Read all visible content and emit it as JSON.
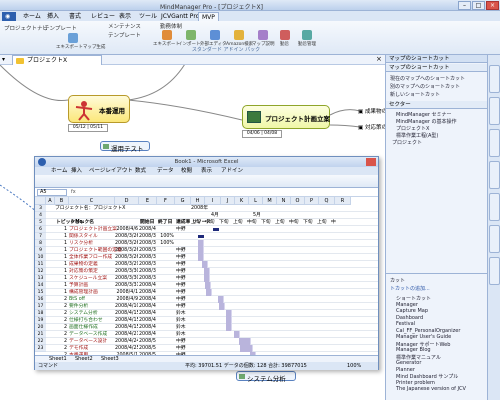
{
  "app": {
    "title": "MindManager Pro - [プロジェクトX]"
  },
  "window_buttons": [
    "–",
    "□",
    "×"
  ],
  "ribbon": {
    "tabs": [
      "ホーム",
      "挿入",
      "書式",
      "レビュー",
      "表示",
      "ツール",
      "JCVGantt Pro",
      "MVP"
    ],
    "left_labels": [
      "プロジェクトナビ",
      "テンプレート"
    ],
    "group2_items": [
      "メンテナンス",
      "テンプレート",
      "勤務体制"
    ],
    "group3_items": [
      "エキスポート",
      "インポート",
      "外部エディタ",
      "Amazon検索",
      "マップ説明",
      "勤怠",
      "勤怠管理"
    ],
    "group3_title": "スタンダード アドイン パック"
  },
  "doc": {
    "tab": "プロジェクトX"
  },
  "map": {
    "node1": "本番運用",
    "node1_dates": "05/12 | 05/11",
    "node2": "運用テスト",
    "node3": "プロジェクト計画立案",
    "node3_dates": "04/06 | 04/08",
    "subtopics": [
      "▣ 成果物の定義",
      "▣ 対応策の策定"
    ],
    "bottom_node": "システム分析"
  },
  "side_panel": {
    "title": "マップのショートカット",
    "sections": [
      "マップのショートカット",
      "セクター"
    ],
    "items": [
      "現在のマップへのショートカット",
      "別のマップへのショートカット",
      "新しいショートカット",
      "MindManager セミナー",
      "MindManager の基本操作",
      "プロジェクトX",
      "標準作業工程(A型)",
      "プロジェクト"
    ],
    "list_items": [
      "ショートカット",
      "Manager",
      "Capture Map",
      "Dashboard",
      "Festival",
      "Cal_FF_PersonalOrganizer",
      "Manager User's Guide",
      "Manager サポートWeb",
      "Manager Blog",
      "標準作業マニュアル",
      "Generator",
      "Planner",
      "Mind Dashboard サンプル",
      "Printer problem",
      "The Japanese version of JCV"
    ],
    "bottom_title": "カット",
    "bottom_link": "トカットの追加..."
  },
  "excel": {
    "title": "Book1 - Microsoft Excel",
    "tabs": [
      "ホーム",
      "挿入",
      "ページレイアウト",
      "数式",
      "データ",
      "校閲",
      "表示",
      "アドイン"
    ],
    "name_box": "A5",
    "columns": [
      "A",
      "B",
      "C",
      "D",
      "E",
      "F",
      "G",
      "H",
      "I",
      "J",
      "K",
      "L",
      "M",
      "N",
      "O",
      "P",
      "Q",
      "R"
    ],
    "sheet_title": "プロジェクト名：プロジェクトX",
    "year_label": "2008年",
    "month_labels": [
      "4月",
      "5月"
    ],
    "half_labels": [
      "上旬",
      "中旬",
      "下旬",
      "上旬",
      "中旬",
      "下旬",
      "上旬",
      "中旬",
      "下旬",
      "上旬",
      "中"
    ],
    "headers": [
      "トピックNo.",
      "トピック名",
      "開始日",
      "終了日",
      "達成率",
      "リソース"
    ],
    "rows": [
      {
        "no": "1",
        "name": "プロジェクト計画立案",
        "start": "2008/4/6",
        "end": "2008/4/8",
        "pct": "",
        "res": "中野"
      },
      {
        "no": "1",
        "name": "関係スタイル",
        "start": "2008/3/26",
        "end": "2008/3/28",
        "pct": "100%",
        "res": ""
      },
      {
        "no": "1",
        "name": "リスク分析",
        "start": "2008/3/26",
        "end": "2008/3/28",
        "pct": "100%",
        "res": ""
      },
      {
        "no": "1",
        "name": "プロジェクト範囲の定義",
        "start": "2008/3/26",
        "end": "2008/3/28",
        "pct": "",
        "res": "中野"
      },
      {
        "no": "1",
        "name": "全体作業フロー作成",
        "start": "2008/3/26",
        "end": "2008/3/28",
        "pct": "",
        "res": "中野"
      },
      {
        "no": "1",
        "name": "成果物の定義",
        "start": "2008/3/29",
        "end": "2008/3/30",
        "pct": "",
        "res": "中野"
      },
      {
        "no": "1",
        "name": "対応策の策定",
        "start": "2008/3/30",
        "end": "2008/3/31",
        "pct": "",
        "res": "中野"
      },
      {
        "no": "1",
        "name": "スケジュール立案",
        "start": "2008/3/30",
        "end": "2008/3/31",
        "pct": "",
        "res": "中野"
      },
      {
        "no": "1",
        "name": "予算計画",
        "start": "2008/3/31",
        "end": "2008/4/1",
        "pct": "",
        "res": "中野"
      },
      {
        "no": "1",
        "name": "構成管理計画",
        "start": "2008/4/1",
        "end": "2008/4/2",
        "pct": "",
        "res": "中野"
      },
      {
        "no": "2",
        "name": "BtS off",
        "start": "2008/4/9",
        "end": "2008/4/9",
        "pct": "",
        "res": "中野"
      },
      {
        "no": "2",
        "name": "要件分析",
        "start": "2008/4/10",
        "end": "2008/4/11",
        "pct": "",
        "res": "中野"
      },
      {
        "no": "2",
        "name": "システム分析",
        "start": "2008/4/15",
        "end": "2008/4/16",
        "pct": "",
        "res": "鈴木"
      },
      {
        "no": "2",
        "name": "仕様打ち合わせ",
        "start": "2008/4/15",
        "end": "2008/4/16",
        "pct": "",
        "res": "鈴木"
      },
      {
        "no": "2",
        "name": "画面仕様作成",
        "start": "2008/4/15",
        "end": "2008/4/17",
        "pct": "",
        "res": "鈴木"
      },
      {
        "no": "2",
        "name": "データベース作成",
        "start": "2008/4/21",
        "end": "2008/4/23",
        "pct": "",
        "res": "鈴木"
      },
      {
        "no": "2",
        "name": "データベース設計",
        "start": "2008/4/24",
        "end": "2008/5/1",
        "pct": "",
        "res": "中野"
      },
      {
        "no": "2",
        "name": "デモ作成",
        "start": "2008/4/25",
        "end": "2008/5/2",
        "pct": "",
        "res": "中野"
      },
      {
        "no": "2",
        "name": "本番運用",
        "start": "2008/5/1",
        "end": "2008/5/2",
        "pct": "",
        "res": "中野"
      }
    ],
    "sheet_tabs": [
      "Sheet1",
      "Sheet2",
      "Sheet3"
    ],
    "status_left": "コマンド",
    "status_right": "平均: 39701.51   データの個数: 128   合計: 39877015",
    "zoom": "100%"
  }
}
